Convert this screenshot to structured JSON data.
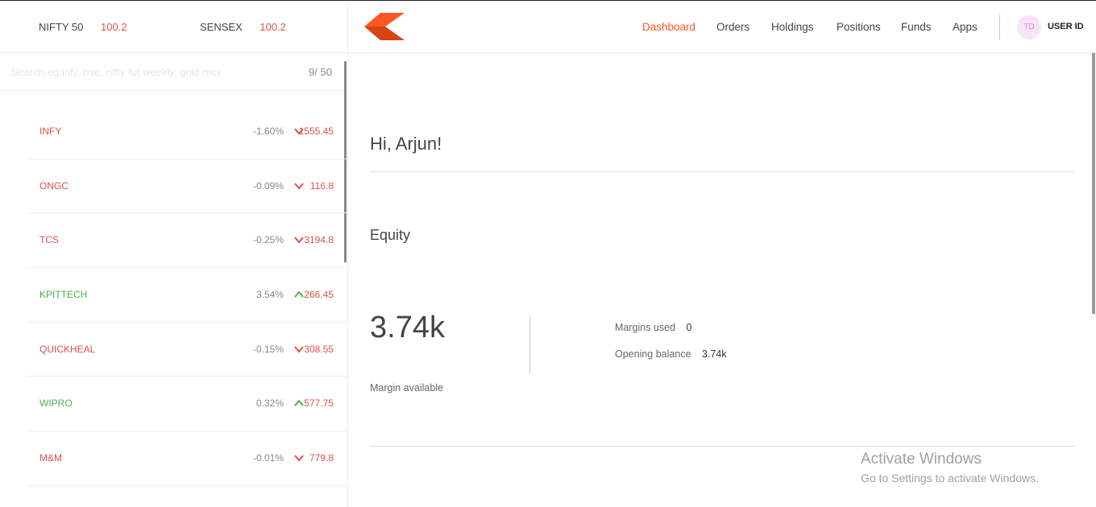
{
  "indices": [
    {
      "name": "NIFTY 50",
      "value": "100.2"
    },
    {
      "name": "SENSEX",
      "value": "100.2"
    }
  ],
  "nav": {
    "items": [
      "Dashboard",
      "Orders",
      "Holdings",
      "Positions",
      "Funds",
      "Apps"
    ],
    "active": "Dashboard",
    "avatar_initials": "TD",
    "user_id": "USER ID"
  },
  "search": {
    "placeholder": "Search eg:infy, bse, nifty fut weekly, gold mcx",
    "count": "9/ 50"
  },
  "watchlist": [
    {
      "symbol": "INFY",
      "change": "-1.60%",
      "price": "1555.45",
      "direction": "down"
    },
    {
      "symbol": "ONGC",
      "change": "-0.09%",
      "price": "116.8",
      "direction": "down"
    },
    {
      "symbol": "TCS",
      "change": "-0.25%",
      "price": "3194.8",
      "direction": "down"
    },
    {
      "symbol": "KPITTECH",
      "change": "3.54%",
      "price": "266.45",
      "direction": "up"
    },
    {
      "symbol": "QUICKHEAL",
      "change": "-0.15%",
      "price": "308.55",
      "direction": "down"
    },
    {
      "symbol": "WIPRO",
      "change": "0.32%",
      "price": "577.75",
      "direction": "up"
    },
    {
      "symbol": "M&M",
      "change": "-0.01%",
      "price": "779.8",
      "direction": "down"
    }
  ],
  "main": {
    "greeting": "Hi, Arjun!",
    "section_title": "Equity",
    "margin_available_value": "3.74k",
    "margin_available_label": "Margin available",
    "margins_used_label": "Margins used",
    "margins_used_value": "0",
    "opening_balance_label": "Opening balance",
    "opening_balance_value": "3.74k"
  },
  "watermark": {
    "title": "Activate Windows",
    "subtitle": "Go to Settings to activate Windows."
  },
  "colors": {
    "accent": "#ff5722",
    "down": "#df514c",
    "up": "#4caf50"
  }
}
